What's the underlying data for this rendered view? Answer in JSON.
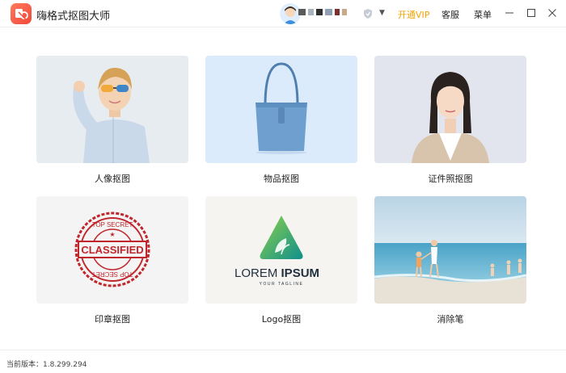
{
  "app": {
    "title": "嗨格式抠图大师"
  },
  "header": {
    "vip_label": "开通VIP",
    "service_label": "客服",
    "menu_label": "菜单",
    "accent_color": "#f5a300"
  },
  "cards": [
    {
      "label": "人像抠图",
      "icon": "person-portrait"
    },
    {
      "label": "物品抠图",
      "icon": "handbag"
    },
    {
      "label": "证件照抠图",
      "icon": "id-photo-woman"
    },
    {
      "label": "印章抠图",
      "icon": "classified-stamp"
    },
    {
      "label": "Logo抠图",
      "icon": "lorem-ipsum-logo"
    },
    {
      "label": "消除笔",
      "icon": "beach-scene"
    }
  ],
  "stamp": {
    "top_text": "TOP SECRET",
    "center_text": "CLASSIFIED",
    "bottom_text": "TOP SECRET"
  },
  "logo_sample": {
    "word1": "LOREM",
    "word2": "IPSUM",
    "tagline": "YOUR TAGLINE"
  },
  "footer": {
    "version": "当前版本：1.8.299.294"
  }
}
